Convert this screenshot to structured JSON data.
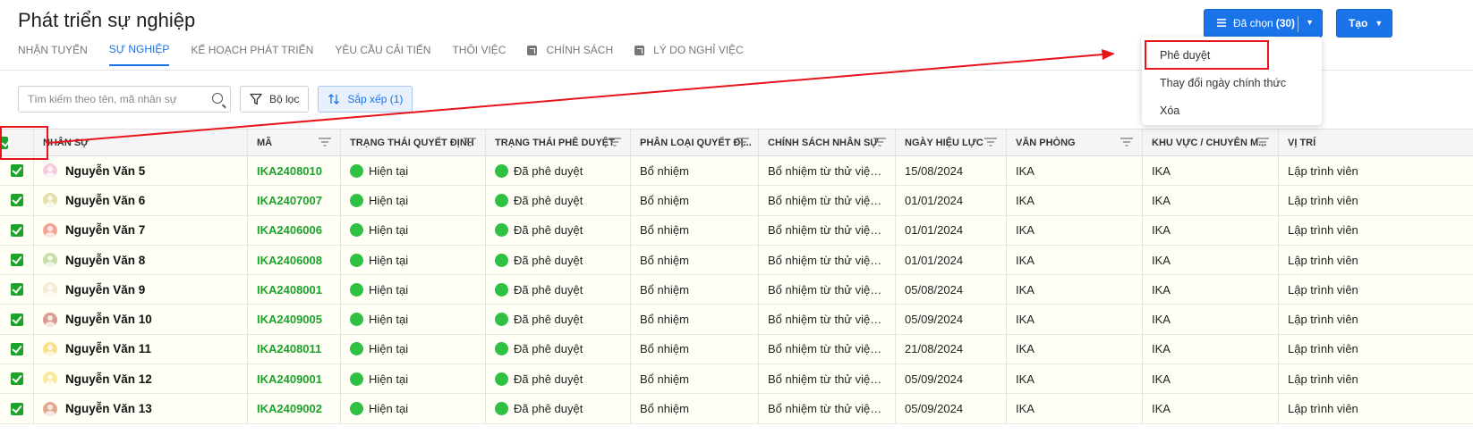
{
  "page_title": "Phát triển sự nghiệp",
  "actions": {
    "selected_label": "Đã chọn",
    "selected_count": "(30)",
    "create_label": "Tạo"
  },
  "tabs": [
    {
      "label": "Nhận tuyển"
    },
    {
      "label": "Sự nghiệp"
    },
    {
      "label": "Kế hoạch phát triển"
    },
    {
      "label": "Yêu cầu cải tiến"
    },
    {
      "label": "Thôi việc"
    },
    {
      "label": "Chính sách"
    },
    {
      "label": "Lý do nghỉ việc"
    }
  ],
  "toolbar": {
    "search_placeholder": "Tìm kiếm theo tên, mã nhân sự",
    "filter_label": "Bộ lọc",
    "sort_label": "Sắp xếp (1)"
  },
  "dropdown": {
    "items": [
      "Phê duyệt",
      "Thay đổi ngày chính thức",
      "Xóa"
    ]
  },
  "table": {
    "headers": [
      "Nhân sự",
      "Mã",
      "Trạng thái quyết định",
      "Trạng thái phê duyệt",
      "Phân loại quyết đị...",
      "Chính sách nhân sự",
      "Ngày hiệu lực",
      "Văn phòng",
      "Khu vực / chuyên m...",
      "Vị trí"
    ],
    "rows": [
      {
        "name": "Nguyễn Văn 5",
        "code": "IKA2408010",
        "decision_status": "Hiện tại",
        "approval_status": "Đã phê duyệt",
        "decision_type": "Bổ nhiệm",
        "policy": "Bổ nhiệm từ thử việc l...",
        "effective_date": "15/08/2024",
        "office": "IKA",
        "region": "IKA",
        "position": "Lập trình viên",
        "avatar_color": "#f6c9dd"
      },
      {
        "name": "Nguyễn Văn 6",
        "code": "IKA2407007",
        "decision_status": "Hiện tại",
        "approval_status": "Đã phê duyệt",
        "decision_type": "Bổ nhiệm",
        "policy": "Bổ nhiệm từ thử việc l...",
        "effective_date": "01/01/2024",
        "office": "IKA",
        "region": "IKA",
        "position": "Lập trình viên",
        "avatar_color": "#e4e0a8"
      },
      {
        "name": "Nguyễn Văn 7",
        "code": "IKA2406006",
        "decision_status": "Hiện tại",
        "approval_status": "Đã phê duyệt",
        "decision_type": "Bổ nhiệm",
        "policy": "Bổ nhiệm từ thử việc l...",
        "effective_date": "01/01/2024",
        "office": "IKA",
        "region": "IKA",
        "position": "Lập trình viên",
        "avatar_color": "#f0a595"
      },
      {
        "name": "Nguyễn Văn 8",
        "code": "IKA2406008",
        "decision_status": "Hiện tại",
        "approval_status": "Đã phê duyệt",
        "decision_type": "Bổ nhiệm",
        "policy": "Bổ nhiệm từ thử việc l...",
        "effective_date": "01/01/2024",
        "office": "IKA",
        "region": "IKA",
        "position": "Lập trình viên",
        "avatar_color": "#c6dfa8"
      },
      {
        "name": "Nguyễn Văn 9",
        "code": "IKA2408001",
        "decision_status": "Hiện tại",
        "approval_status": "Đã phê duyệt",
        "decision_type": "Bổ nhiệm",
        "policy": "Bổ nhiệm từ thử việc l...",
        "effective_date": "05/08/2024",
        "office": "IKA",
        "region": "IKA",
        "position": "Lập trình viên",
        "avatar_color": "#f3ead3"
      },
      {
        "name": "Nguyễn Văn 10",
        "code": "IKA2409005",
        "decision_status": "Hiện tại",
        "approval_status": "Đã phê duyệt",
        "decision_type": "Bổ nhiệm",
        "policy": "Bổ nhiệm từ thử việc l...",
        "effective_date": "05/09/2024",
        "office": "IKA",
        "region": "IKA",
        "position": "Lập trình viên",
        "avatar_color": "#d99a92"
      },
      {
        "name": "Nguyễn Văn 11",
        "code": "IKA2408011",
        "decision_status": "Hiện tại",
        "approval_status": "Đã phê duyệt",
        "decision_type": "Bổ nhiệm",
        "policy": "Bổ nhiệm từ thử việc l...",
        "effective_date": "21/08/2024",
        "office": "IKA",
        "region": "IKA",
        "position": "Lập trình viên",
        "avatar_color": "#f7df8d"
      },
      {
        "name": "Nguyễn Văn 12",
        "code": "IKA2409001",
        "decision_status": "Hiện tại",
        "approval_status": "Đã phê duyệt",
        "decision_type": "Bổ nhiệm",
        "policy": "Bổ nhiệm từ thử việc l...",
        "effective_date": "05/09/2024",
        "office": "IKA",
        "region": "IKA",
        "position": "Lập trình viên",
        "avatar_color": "#f9e79a"
      },
      {
        "name": "Nguyễn Văn 13",
        "code": "IKA2409002",
        "decision_status": "Hiện tại",
        "approval_status": "Đã phê duyệt",
        "decision_type": "Bổ nhiệm",
        "policy": "Bổ nhiệm từ thử việc l...",
        "effective_date": "05/09/2024",
        "office": "IKA",
        "region": "IKA",
        "position": "Lập trình viên",
        "avatar_color": "#e0ab8e"
      }
    ]
  },
  "colors": {
    "primary": "#1a73e8",
    "success": "#1ba32a",
    "status_dot": "#2ec144",
    "annotation": "#e8141b"
  }
}
